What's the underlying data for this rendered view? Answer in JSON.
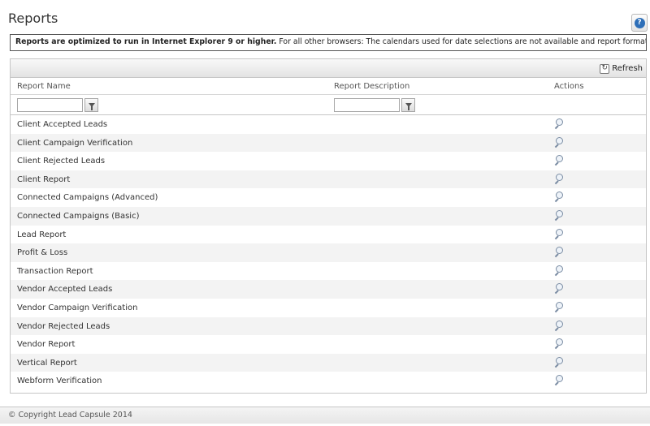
{
  "page": {
    "title": "Reports",
    "help_label": "?"
  },
  "notice": {
    "bold": "Reports are optimized to run in Internet Explorer 9 or higher.",
    "rest": " For all other browsers: The calendars used for date selections are not available and report formatting may vary."
  },
  "toolbar": {
    "refresh_label": "Refresh"
  },
  "columns": {
    "name": "Report Name",
    "description": "Report Description",
    "actions": "Actions"
  },
  "filters": {
    "name_value": "",
    "description_value": ""
  },
  "reports": [
    {
      "name": "Client Accepted Leads",
      "description": ""
    },
    {
      "name": "Client Campaign Verification",
      "description": ""
    },
    {
      "name": "Client Rejected Leads",
      "description": ""
    },
    {
      "name": "Client Report",
      "description": ""
    },
    {
      "name": "Connected Campaigns (Advanced)",
      "description": ""
    },
    {
      "name": "Connected Campaigns (Basic)",
      "description": ""
    },
    {
      "name": "Lead Report",
      "description": ""
    },
    {
      "name": "Profit & Loss",
      "description": ""
    },
    {
      "name": "Transaction Report",
      "description": ""
    },
    {
      "name": "Vendor Accepted Leads",
      "description": ""
    },
    {
      "name": "Vendor Campaign Verification",
      "description": ""
    },
    {
      "name": "Vendor Rejected Leads",
      "description": ""
    },
    {
      "name": "Vendor Report",
      "description": ""
    },
    {
      "name": "Vertical Report",
      "description": ""
    },
    {
      "name": "Webform Verification",
      "description": ""
    }
  ],
  "icons": {
    "help": "help-icon",
    "refresh": "refresh-icon",
    "filter": "filter-icon",
    "view": "magnifier-icon"
  },
  "footer": {
    "copyright": "© Copyright Lead Capsule 2014"
  }
}
